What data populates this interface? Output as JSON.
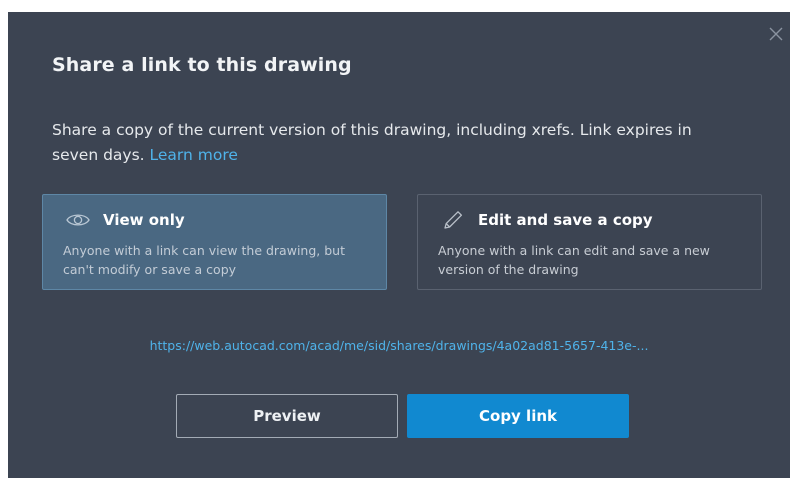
{
  "dialog": {
    "title": "Share a link to this drawing",
    "description": "Share a copy of the current version of this drawing, including xrefs. Link expires in seven days.",
    "learn_more": "Learn more",
    "close_icon": "close-icon"
  },
  "options": {
    "view": {
      "title": "View only",
      "description": "Anyone with a link can view the drawing, but can't modify or save a copy",
      "icon": "eye-icon",
      "selected": true
    },
    "edit": {
      "title": "Edit and save a copy",
      "description": "Anyone with a link can edit and save a new version of the drawing",
      "icon": "pencil-icon",
      "selected": false
    }
  },
  "link": {
    "url": "https://web.autocad.com/acad/me/sid/shares/drawings/4a02ad81-5657-413e-..."
  },
  "buttons": {
    "preview": "Preview",
    "copy": "Copy link"
  },
  "colors": {
    "dialog_bg": "#3c4452",
    "selected_bg": "#4a6882",
    "accent": "#1189d0",
    "link": "#4fb3ea"
  }
}
